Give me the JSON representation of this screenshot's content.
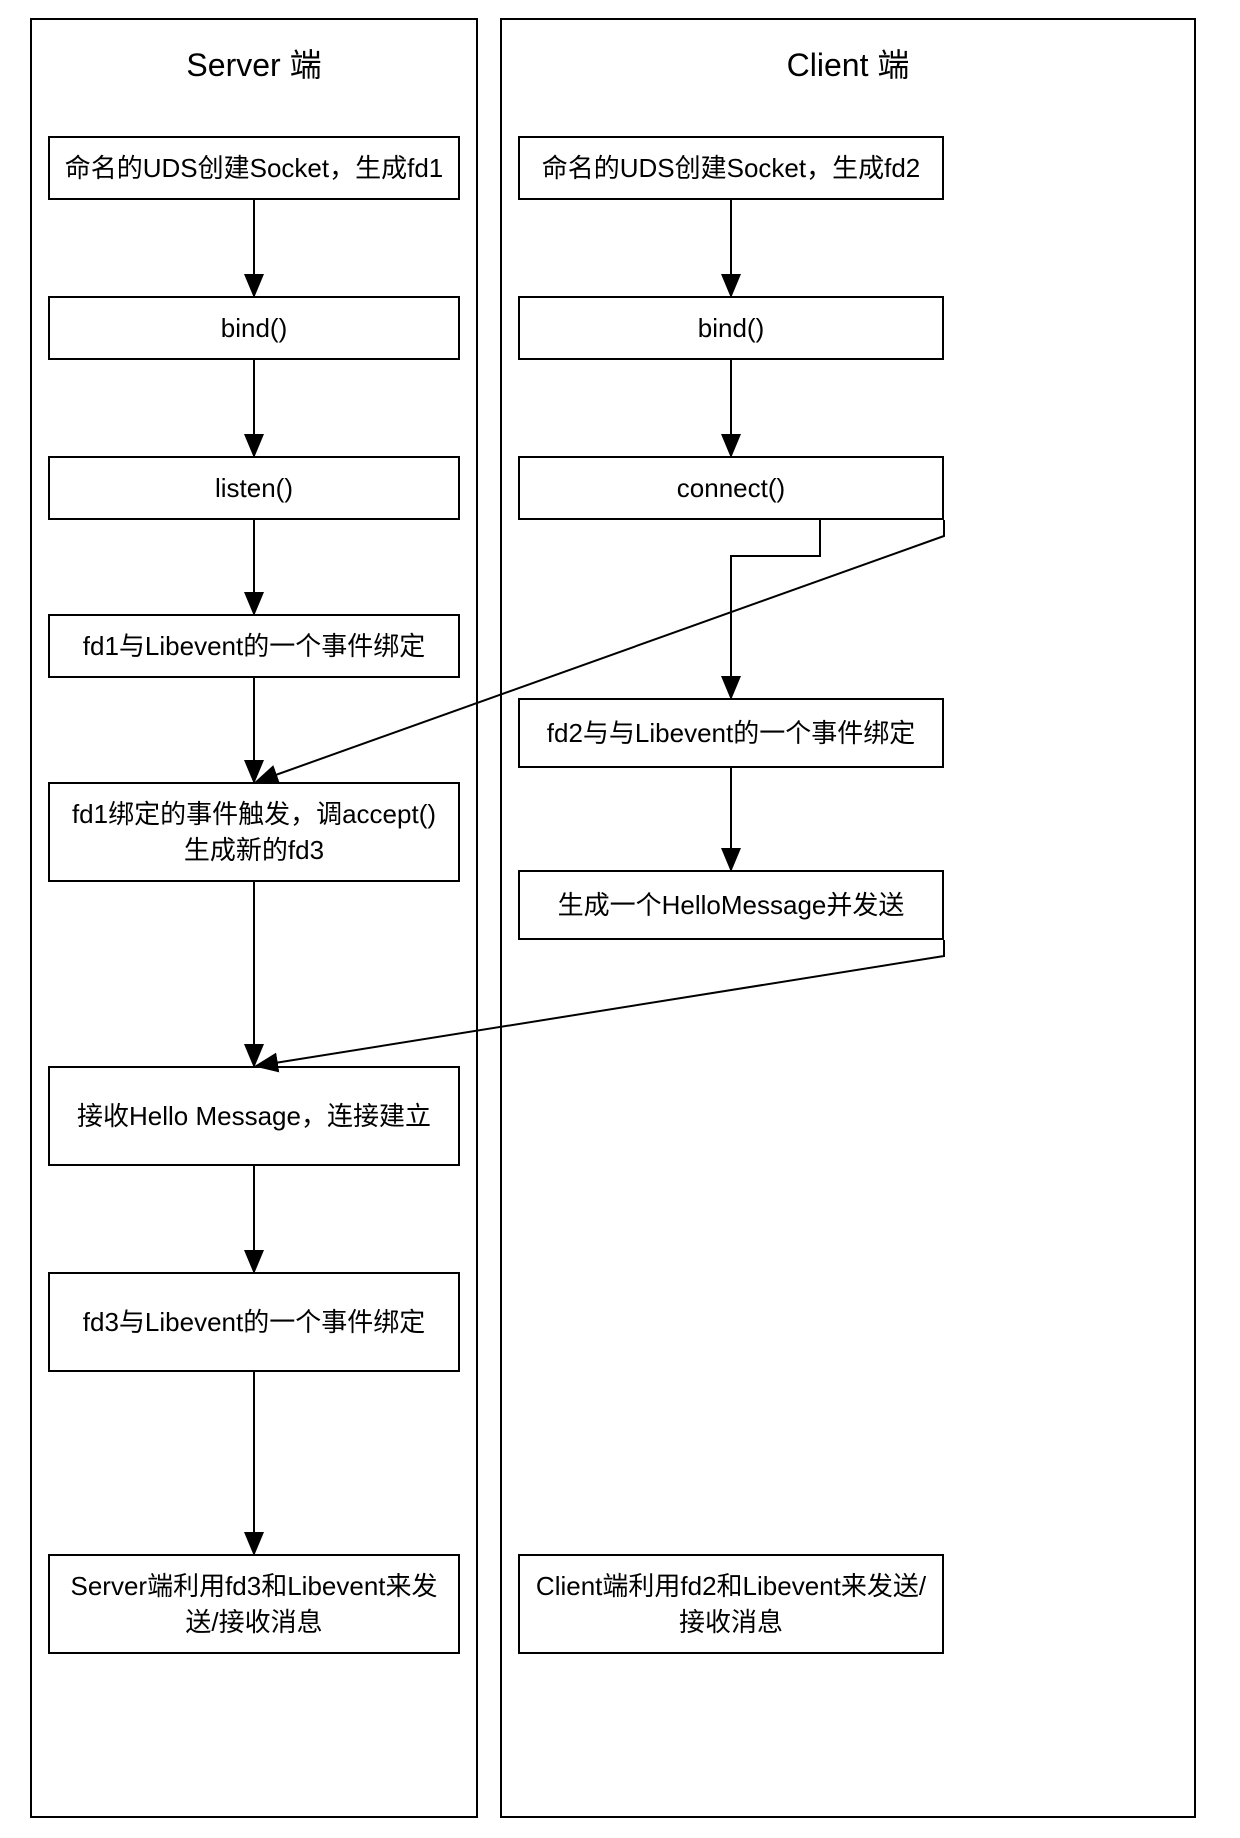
{
  "server": {
    "title": "Server 端",
    "steps": [
      "命名的UDS创建Socket，生成fd1",
      "bind()",
      "listen()",
      "fd1与Libevent的一个事件绑定",
      "fd1绑定的事件触发，调accept()\n生成新的fd3",
      "接收Hello Message，连接建立",
      "fd3与Libevent的一个事件绑定",
      "Server端利用fd3和Libevent来发送/接收消息"
    ]
  },
  "client": {
    "title": "Client 端",
    "steps": [
      "命名的UDS创建Socket，生成fd2",
      "bind()",
      "connect()",
      "fd2与与Libevent的一个事件绑定",
      "生成一个HelloMessage并发送",
      "Client端利用fd2和Libevent来发送/接收消息"
    ]
  }
}
